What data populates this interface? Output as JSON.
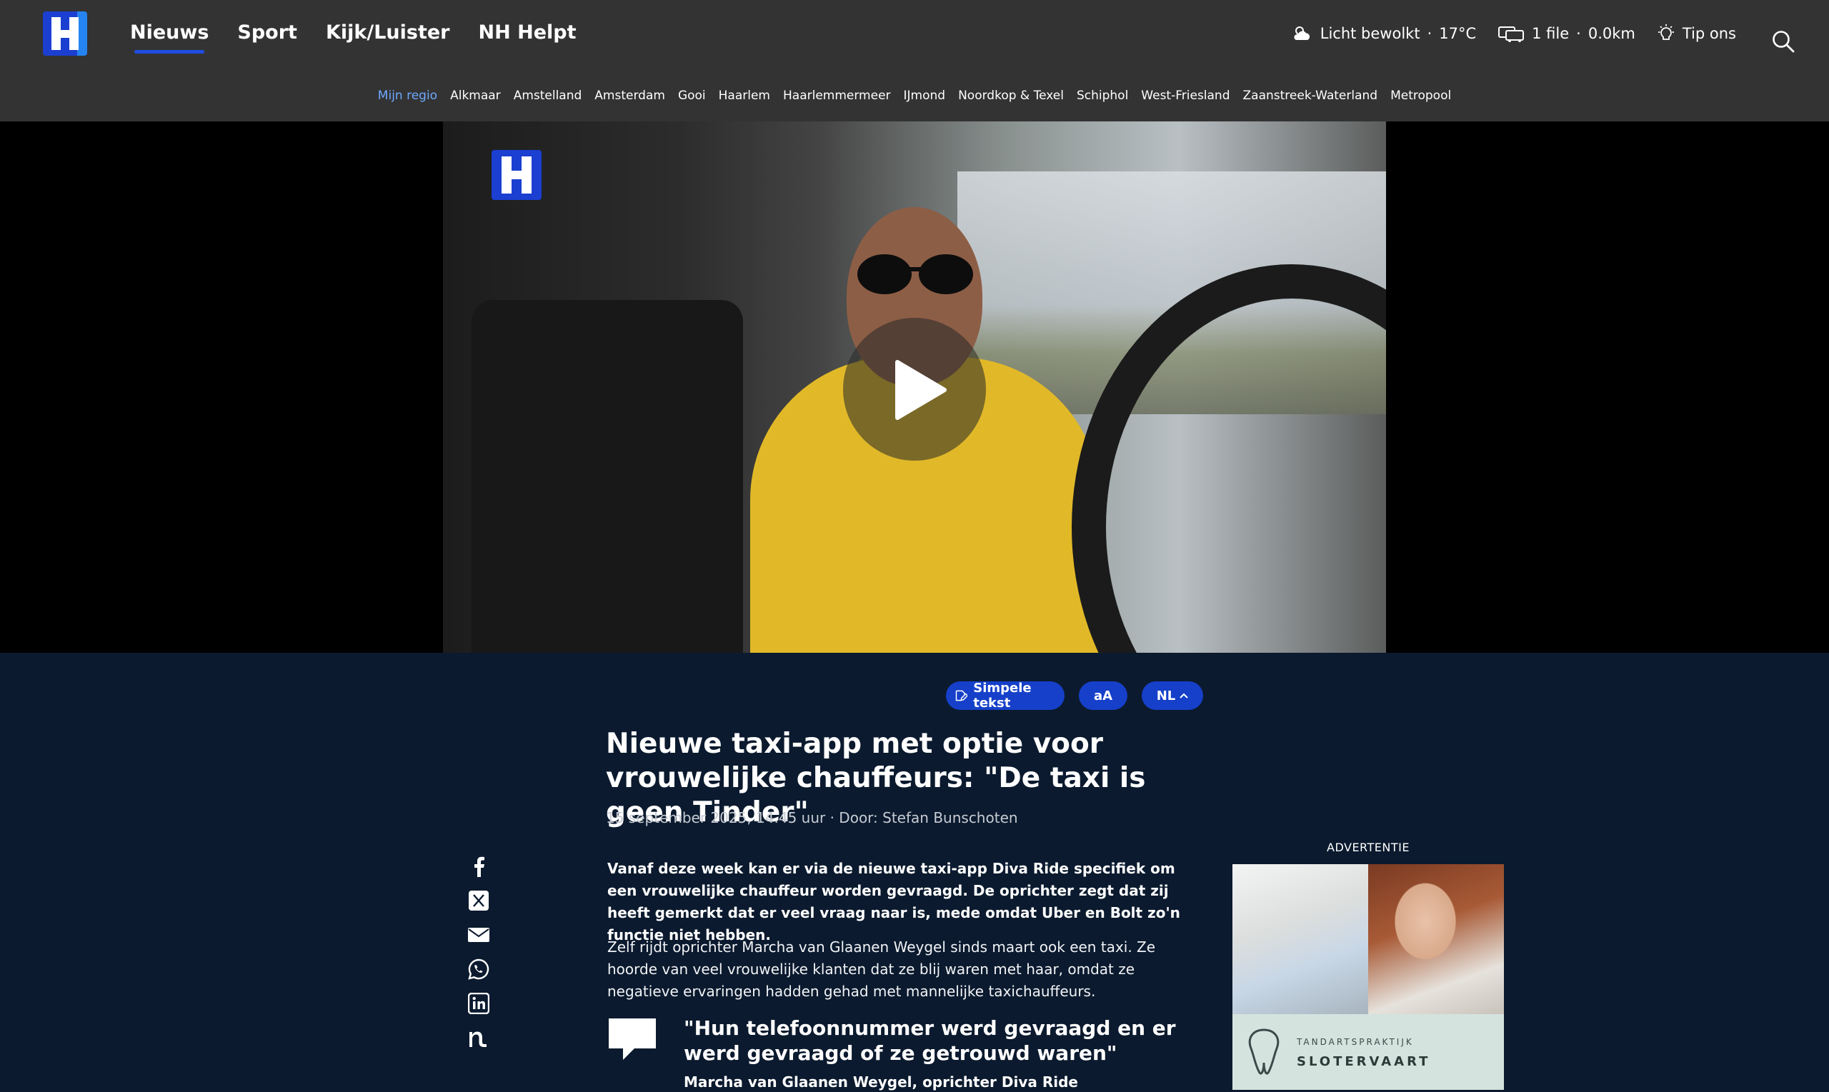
{
  "header": {
    "nav": [
      "Nieuws",
      "Sport",
      "Kijk/Luister",
      "NH Helpt"
    ],
    "weather": "Licht bewolkt",
    "temperature": "17°C",
    "traffic_files": "1 file",
    "traffic_km": "0.0km",
    "tip": "Tip ons",
    "regions": [
      "Mijn regio",
      "Alkmaar",
      "Amstelland",
      "Amsterdam",
      "Gooi",
      "Haarlem",
      "Haarlemmermeer",
      "IJmond",
      "Noordkop & Texel",
      "Schiphol",
      "West-Friesland",
      "Zaanstreek-Waterland",
      "Metropool"
    ]
  },
  "article": {
    "tools": {
      "simple_text": "Simpele tekst",
      "font_size": "aA",
      "language": "NL"
    },
    "title": "Nieuwe taxi-app met optie voor vrouwelijke chauffeurs: \"De taxi is geen Tinder\"",
    "meta": "15 september 2025, 14.45 uur · Door: Stefan Bunschoten",
    "lead": "Vanaf deze week kan er via de nieuwe taxi-app Diva Ride specifiek om een vrouwelijke chauffeur worden gevraagd. De oprichter zegt dat zij heeft gemerkt dat er veel vraag naar is, mede omdat Uber en Bolt zo'n functie niet hebben.",
    "paragraph": "Zelf rijdt oprichter Marcha van Glaanen Weygel sinds maart ook een taxi. Ze hoorde van veel vrouwelijke klanten dat ze blij waren met haar, omdat ze negatieve ervaringen hadden gehad met mannelijke taxichauffeurs.",
    "quote": "\"Hun telefoonnummer werd gevraagd en er werd gevraagd of ze getrouwd waren\"",
    "quote_attribution": "Marcha van Glaanen Weygel, oprichter Diva Ride"
  },
  "ad": {
    "label": "ADVERTENTIE",
    "brand_small": "TANDARTSPRAKTIJK",
    "brand_name": "SLOTERVAART"
  },
  "colors": {
    "accent": "#1640c9",
    "region_active": "#6ea9ff",
    "background": "#0b1a2e",
    "header": "#333333"
  }
}
